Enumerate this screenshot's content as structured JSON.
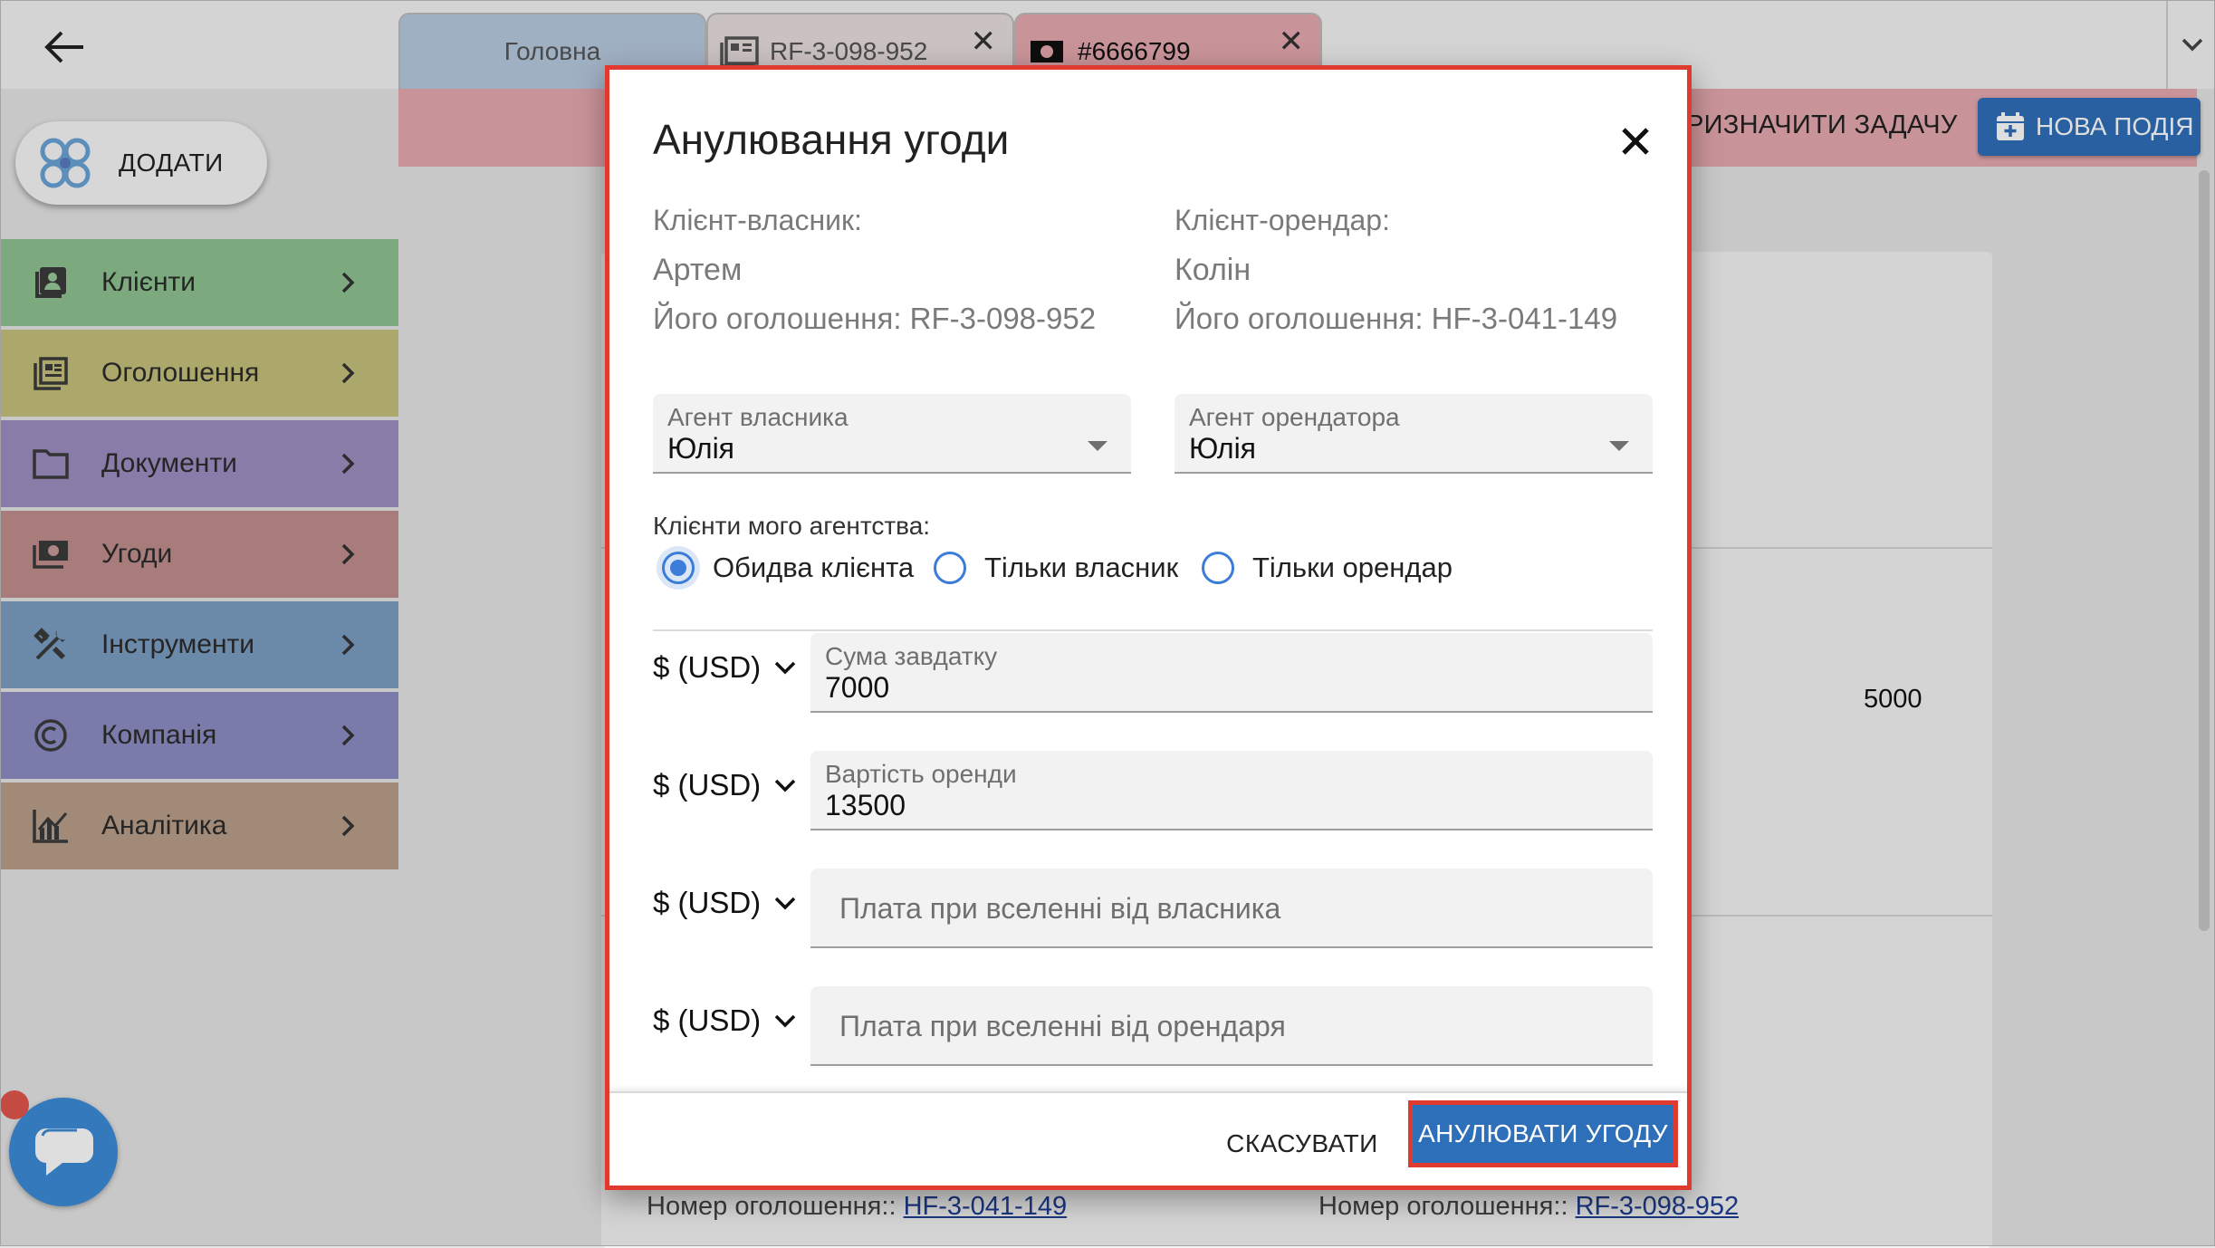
{
  "app": {
    "add_button_label": "ДОДАТИ",
    "sidebar": [
      {
        "label": "Клієнти",
        "icon": "contacts-icon",
        "color": "#8fc390"
      },
      {
        "label": "Оголошення",
        "icon": "listings-icon",
        "color": "#c6c17b"
      },
      {
        "label": "Документи",
        "icon": "folder-icon",
        "color": "#9e8fc1"
      },
      {
        "label": "Угоди",
        "icon": "deals-icon",
        "color": "#c08f8e"
      },
      {
        "label": "Інструменти",
        "icon": "tools-icon",
        "color": "#7b9ec1"
      },
      {
        "label": "Компанія",
        "icon": "company-icon",
        "color": "#8d8ec4"
      },
      {
        "label": "Аналітика",
        "icon": "analytics-icon",
        "color": "#bb9f8a"
      }
    ],
    "tabs": [
      {
        "label": "Головна"
      },
      {
        "label": "RF-3-098-952"
      },
      {
        "label": "#6666799"
      }
    ],
    "assign_task_label": "РИЗНАЧИТИ ЗАДАЧУ",
    "new_event_label": "НОВА ПОДІЯ",
    "bg_value": "5000",
    "bg_listing_label": "Номер оголошення::",
    "bg_listing_1": "HF-3-041-149",
    "bg_listing_2": "RF-3-098-952",
    "colors": {
      "accent": "#2e6fba",
      "tab_active": "#e7aab0",
      "highlight": "#e03a2f"
    }
  },
  "dialog": {
    "title": "Анулювання угоди",
    "owner": {
      "label": "Клієнт-власник:",
      "name": "Артем",
      "listing": "Його оголошення: RF-3-098-952"
    },
    "tenant": {
      "label": "Клієнт-орендар:",
      "name": "Колін",
      "listing": "Його оголошення: HF-3-041-149"
    },
    "owner_agent": {
      "label": "Агент власника",
      "value": "Юлія"
    },
    "tenant_agent": {
      "label": "Агент орендатора",
      "value": "Юлія"
    },
    "agency_clients_label": "Клієнти мого агентства:",
    "radio_options": [
      {
        "label": "Обидва клієнта",
        "checked": true
      },
      {
        "label": "Тільки власник",
        "checked": false
      },
      {
        "label": "Тільки орендар",
        "checked": false
      }
    ],
    "money_rows": [
      {
        "currency": "$ (USD)",
        "label": "Сума завдатку",
        "value": "7000",
        "placeholder": ""
      },
      {
        "currency": "$ (USD)",
        "label": "Вартість оренди",
        "value": "13500",
        "placeholder": ""
      },
      {
        "currency": "$ (USD)",
        "label": "",
        "value": "",
        "placeholder": "Плата при вселенні від власника"
      },
      {
        "currency": "$ (USD)",
        "label": "",
        "value": "",
        "placeholder": "Плата при вселенні від орендаря"
      }
    ],
    "cancel_label": "СКАСУВАТИ",
    "confirm_label": "АНУЛЮВАТИ УГОДУ"
  }
}
